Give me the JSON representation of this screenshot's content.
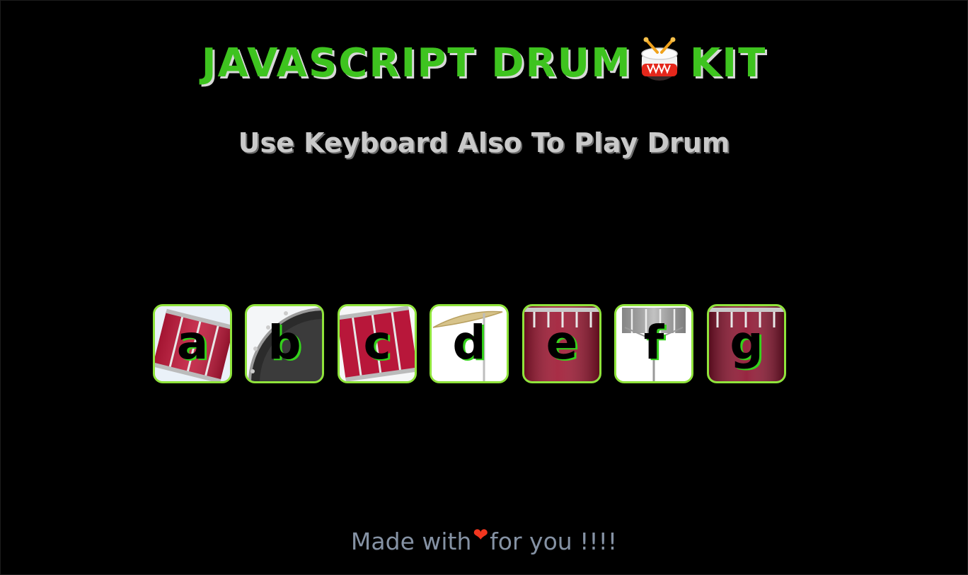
{
  "header": {
    "title_left": "JAVASCRIPT DRUM",
    "title_right": "KIT",
    "title_emoji": "drum-icon",
    "subtitle": "Use Keyboard Also To Play Drum"
  },
  "drums": [
    {
      "key": "a",
      "art": "tom-drum"
    },
    {
      "key": "b",
      "art": "bass-drum"
    },
    {
      "key": "c",
      "art": "tom-drum"
    },
    {
      "key": "d",
      "art": "cymbal"
    },
    {
      "key": "e",
      "art": "floor-tom"
    },
    {
      "key": "f",
      "art": "snare-stand"
    },
    {
      "key": "g",
      "art": "floor-tom"
    }
  ],
  "footer": {
    "text_before": "Made with",
    "heart": "❤",
    "text_after": "for you !!!!"
  },
  "colors": {
    "background": "#000000",
    "title": "#3ec31f",
    "subtitle": "#c9c9c9",
    "drum_border": "#8fe33b",
    "letter_shadow": "#35d21c",
    "footer": "#8592a4",
    "heart": "#f2361f"
  }
}
